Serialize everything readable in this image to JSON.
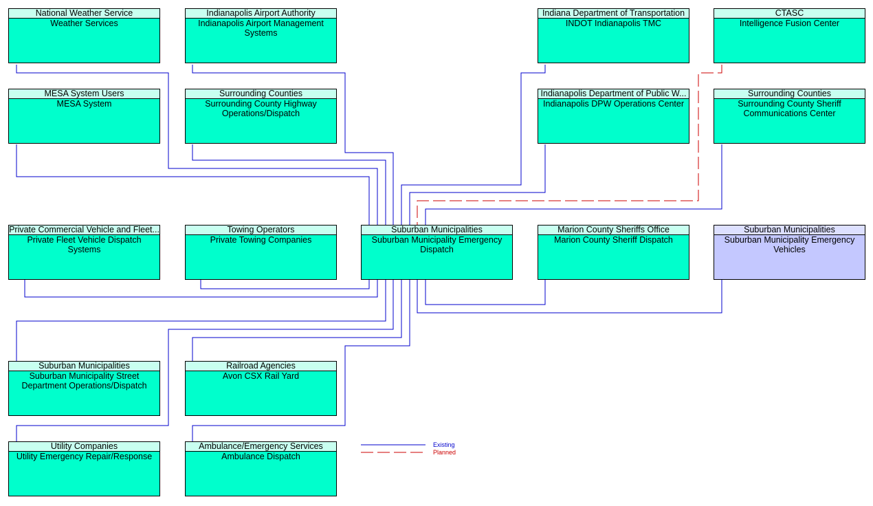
{
  "colors": {
    "existing": "#0000cc",
    "planned": "#cc0000",
    "element": "#00ffcc",
    "subsystem_highlight": "#c4c8ff"
  },
  "center": {
    "id": "center",
    "owner": "Suburban Municipalities",
    "name": "Suburban Municipality Emergency Dispatch"
  },
  "elements": [
    {
      "id": "nws",
      "owner": "National Weather Service",
      "name": "Weather Services",
      "status": "existing"
    },
    {
      "id": "airport",
      "owner": "Indianapolis Airport Authority",
      "name": "Indianapolis Airport Management Systems",
      "status": "existing"
    },
    {
      "id": "indot",
      "owner": "Indiana Department of Transportation",
      "name": "INDOT Indianapolis TMC",
      "status": "existing"
    },
    {
      "id": "ctasc",
      "owner": "CTASC",
      "name": "Intelligence Fusion Center",
      "status": "planned"
    },
    {
      "id": "mesa",
      "owner": "MESA System Users",
      "name": "MESA System",
      "status": "existing"
    },
    {
      "id": "schwy",
      "owner": "Surrounding Counties",
      "name": "Surrounding County Highway Operations/Dispatch",
      "status": "existing"
    },
    {
      "id": "dpw",
      "owner": "Indianapolis Department of Public W...",
      "name": "Indianapolis DPW Operations Center",
      "status": "existing"
    },
    {
      "id": "scsheriff",
      "owner": "Surrounding Counties",
      "name": "Surrounding County Sheriff Communications Center",
      "status": "existing"
    },
    {
      "id": "fleet",
      "owner": "Private Commercial Vehicle and Fleet...",
      "name": "Private Fleet Vehicle Dispatch Systems",
      "status": "existing"
    },
    {
      "id": "towing",
      "owner": "Towing Operators",
      "name": "Private Towing Companies",
      "status": "existing"
    },
    {
      "id": "marion",
      "owner": "Marion County Sheriffs Office",
      "name": "Marion County Sheriff Dispatch",
      "status": "existing"
    },
    {
      "id": "vehicles",
      "owner": "Suburban Municipalities",
      "name": "Suburban Municipality Emergency Vehicles",
      "status": "existing"
    },
    {
      "id": "street",
      "owner": "Suburban Municipalities",
      "name": "Suburban Municipality Street Department Operations/Dispatch",
      "status": "existing"
    },
    {
      "id": "rail",
      "owner": "Railroad Agencies",
      "name": "Avon CSX Rail Yard",
      "status": "existing"
    },
    {
      "id": "utility",
      "owner": "Utility Companies",
      "name": "Utility Emergency Repair/Response",
      "status": "existing"
    },
    {
      "id": "ambulance",
      "owner": "Ambulance/Emergency Services",
      "name": "Ambulance Dispatch",
      "status": "existing"
    }
  ],
  "legend": {
    "existing": "Existing",
    "planned": "Planned"
  }
}
